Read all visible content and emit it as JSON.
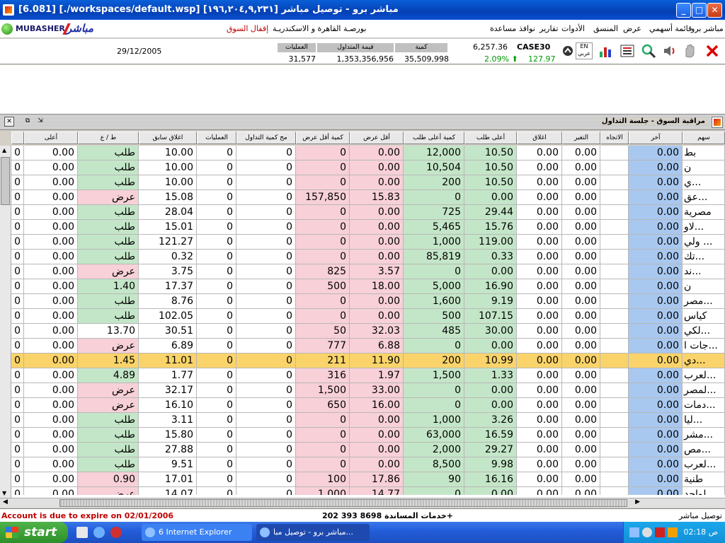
{
  "window": {
    "title": "[6.081]  [./workspaces/default.wsp]  مباشر برو - توصيل مباشر [١٩٦,٢٠٤,٩,٢٣١]",
    "minimize": "_",
    "maximize": "□",
    "close": "✕"
  },
  "logo": {
    "word": "MUBASHER",
    "arabic": "مباشر"
  },
  "menu": {
    "items": [
      "مباشر برو",
      "قائمة أسهمي",
      "عرض",
      "المنسق",
      "الأدوات",
      "تقارير",
      "نوافذ",
      "مساعدة"
    ],
    "exchange": "بورصـة القاهرة و الاسكندريـة",
    "market_status": "إقفال السوق"
  },
  "infobar": {
    "date": "29/12/2005",
    "labels": {
      "trades": "العمليات",
      "value": "قيمة المتداول",
      "volume": "كمية"
    },
    "values": {
      "trades": "31,577",
      "value": "1,353,356,956",
      "volume": "35,509,998"
    },
    "index_name": "CASE30",
    "index_value": "6,257.36",
    "index_pct": "2.09%",
    "index_change": "127.97",
    "lang_btn": "EN عربي",
    "colors": {
      "up": "#009900",
      "expire": "#c00000"
    }
  },
  "panel": {
    "title": "مراقبة السوق - جلسة التداول"
  },
  "columns": [
    "أعلى",
    "ط / ع",
    "اغلاق سابق",
    "العمليات",
    "مج كمية التداول",
    "كمية أقل عرض",
    "أقل عرض",
    "كمية أعلى طلب",
    "أعلى طلب",
    "اغلاق",
    "التغير",
    "الاتجاه",
    "آخر",
    "سهم"
  ],
  "rows": [
    {
      "high": "0.00",
      "bs": "طلب",
      "bs_type": "bid",
      "prev": "10.00",
      "trades": "0",
      "vol": "0",
      "ask_qty": "0",
      "ask": "0.00",
      "bid_qty": "12,000",
      "bid": "10.50",
      "close": "0.00",
      "chg": "0.00",
      "last": "0.00",
      "sym": "بط"
    },
    {
      "high": "0.00",
      "bs": "طلب",
      "bs_type": "bid",
      "prev": "10.00",
      "trades": "0",
      "vol": "0",
      "ask_qty": "0",
      "ask": "0.00",
      "bid_qty": "10,504",
      "bid": "10.50",
      "close": "0.00",
      "chg": "0.00",
      "last": "0.00",
      "sym": "ن"
    },
    {
      "high": "0.00",
      "bs": "طلب",
      "bs_type": "bid",
      "prev": "10.00",
      "trades": "0",
      "vol": "0",
      "ask_qty": "0",
      "ask": "0.00",
      "bid_qty": "200",
      "bid": "10.50",
      "close": "0.00",
      "chg": "0.00",
      "last": "0.00",
      "sym": "ي..."
    },
    {
      "high": "0.00",
      "bs": "عرض",
      "bs_type": "ask",
      "prev": "15.08",
      "trades": "0",
      "vol": "0",
      "ask_qty": "157,850",
      "ask": "15.83",
      "bid_qty": "0",
      "bid": "0.00",
      "close": "0.00",
      "chg": "0.00",
      "last": "0.00",
      "sym": "عق..."
    },
    {
      "high": "0.00",
      "bs": "طلب",
      "bs_type": "bid",
      "prev": "28.04",
      "trades": "0",
      "vol": "0",
      "ask_qty": "0",
      "ask": "0.00",
      "bid_qty": "725",
      "bid": "29.44",
      "close": "0.00",
      "chg": "0.00",
      "last": "0.00",
      "sym": "مصرية"
    },
    {
      "high": "0.00",
      "bs": "طلب",
      "bs_type": "bid",
      "prev": "15.01",
      "trades": "0",
      "vol": "0",
      "ask_qty": "0",
      "ask": "0.00",
      "bid_qty": "5,465",
      "bid": "15.76",
      "close": "0.00",
      "chg": "0.00",
      "last": "0.00",
      "sym": "لاو..."
    },
    {
      "high": "0.00",
      "bs": "طلب",
      "bs_type": "bid",
      "prev": "121.27",
      "trades": "0",
      "vol": "0",
      "ask_qty": "0",
      "ask": "0.00",
      "bid_qty": "1,000",
      "bid": "119.00",
      "close": "0.00",
      "chg": "0.00",
      "last": "0.00",
      "sym": "ولي ..."
    },
    {
      "high": "0.00",
      "bs": "طلب",
      "bs_type": "bid",
      "prev": "0.32",
      "trades": "0",
      "vol": "0",
      "ask_qty": "0",
      "ask": "0.00",
      "bid_qty": "85,819",
      "bid": "0.33",
      "close": "0.00",
      "chg": "0.00",
      "last": "0.00",
      "sym": "تك..."
    },
    {
      "high": "0.00",
      "bs": "عرض",
      "bs_type": "ask",
      "prev": "3.75",
      "trades": "0",
      "vol": "0",
      "ask_qty": "825",
      "ask": "3.57",
      "bid_qty": "0",
      "bid": "0.00",
      "close": "0.00",
      "chg": "0.00",
      "last": "0.00",
      "sym": "ند..."
    },
    {
      "high": "0.00",
      "bs": "1.40",
      "bs_type": "bid",
      "prev": "17.37",
      "trades": "0",
      "vol": "0",
      "ask_qty": "500",
      "ask": "18.00",
      "bid_qty": "5,000",
      "bid": "16.90",
      "close": "0.00",
      "chg": "0.00",
      "last": "0.00",
      "sym": "ن"
    },
    {
      "high": "0.00",
      "bs": "طلب",
      "bs_type": "bid",
      "prev": "8.76",
      "trades": "0",
      "vol": "0",
      "ask_qty": "0",
      "ask": "0.00",
      "bid_qty": "1,600",
      "bid": "9.19",
      "close": "0.00",
      "chg": "0.00",
      "last": "0.00",
      "sym": "مصر..."
    },
    {
      "high": "0.00",
      "bs": "طلب",
      "bs_type": "bid",
      "prev": "102.05",
      "trades": "0",
      "vol": "0",
      "ask_qty": "0",
      "ask": "0.00",
      "bid_qty": "500",
      "bid": "107.15",
      "close": "0.00",
      "chg": "0.00",
      "last": "0.00",
      "sym": "كياس"
    },
    {
      "high": "0.00",
      "bs": "13.70",
      "bs_type": "plain",
      "prev": "30.51",
      "trades": "0",
      "vol": "0",
      "ask_qty": "50",
      "ask": "32.03",
      "bid_qty": "485",
      "bid": "30.00",
      "close": "0.00",
      "chg": "0.00",
      "last": "0.00",
      "sym": "لكي..."
    },
    {
      "high": "0.00",
      "bs": "عرض",
      "bs_type": "ask",
      "prev": "6.89",
      "trades": "0",
      "vol": "0",
      "ask_qty": "777",
      "ask": "6.88",
      "bid_qty": "0",
      "bid": "0.00",
      "close": "0.00",
      "chg": "0.00",
      "last": "0.00",
      "sym": "جات ا..."
    },
    {
      "high": "0.00",
      "bs": "1.45",
      "bs_type": "bid",
      "prev": "11.01",
      "trades": "0",
      "vol": "0",
      "ask_qty": "211",
      "ask": "11.90",
      "bid_qty": "200",
      "bid": "10.99",
      "close": "0.00",
      "chg": "0.00",
      "last": "0.00",
      "sym": "دي...",
      "highlight": true
    },
    {
      "high": "0.00",
      "bs": "4.89",
      "bs_type": "bid",
      "prev": "1.77",
      "trades": "0",
      "vol": "0",
      "ask_qty": "316",
      "ask": "1.97",
      "bid_qty": "1,500",
      "bid": "1.33",
      "close": "0.00",
      "chg": "0.00",
      "last": "0.00",
      "sym": "لعرب..."
    },
    {
      "high": "0.00",
      "bs": "عرض",
      "bs_type": "ask",
      "prev": "32.17",
      "trades": "0",
      "vol": "0",
      "ask_qty": "1,500",
      "ask": "33.00",
      "bid_qty": "0",
      "bid": "0.00",
      "close": "0.00",
      "chg": "0.00",
      "last": "0.00",
      "sym": "لمصر..."
    },
    {
      "high": "0.00",
      "bs": "عرض",
      "bs_type": "ask",
      "prev": "16.10",
      "trades": "0",
      "vol": "0",
      "ask_qty": "650",
      "ask": "16.00",
      "bid_qty": "0",
      "bid": "0.00",
      "close": "0.00",
      "chg": "0.00",
      "last": "0.00",
      "sym": "دمات..."
    },
    {
      "high": "0.00",
      "bs": "طلب",
      "bs_type": "bid",
      "prev": "3.11",
      "trades": "0",
      "vol": "0",
      "ask_qty": "0",
      "ask": "0.00",
      "bid_qty": "1,000",
      "bid": "3.26",
      "close": "0.00",
      "chg": "0.00",
      "last": "0.00",
      "sym": "ليا..."
    },
    {
      "high": "0.00",
      "bs": "طلب",
      "bs_type": "bid",
      "prev": "15.80",
      "trades": "0",
      "vol": "0",
      "ask_qty": "0",
      "ask": "0.00",
      "bid_qty": "63,000",
      "bid": "16.59",
      "close": "0.00",
      "chg": "0.00",
      "last": "0.00",
      "sym": "مشر..."
    },
    {
      "high": "0.00",
      "bs": "طلب",
      "bs_type": "bid",
      "prev": "27.88",
      "trades": "0",
      "vol": "0",
      "ask_qty": "0",
      "ask": "0.00",
      "bid_qty": "2,000",
      "bid": "29.27",
      "close": "0.00",
      "chg": "0.00",
      "last": "0.00",
      "sym": "مص..."
    },
    {
      "high": "0.00",
      "bs": "طلب",
      "bs_type": "bid",
      "prev": "9.51",
      "trades": "0",
      "vol": "0",
      "ask_qty": "0",
      "ask": "0.00",
      "bid_qty": "8,500",
      "bid": "9.98",
      "close": "0.00",
      "chg": "0.00",
      "last": "0.00",
      "sym": "لعرب..."
    },
    {
      "high": "0.00",
      "bs": "0.90",
      "bs_type": "ask",
      "prev": "17.01",
      "trades": "0",
      "vol": "0",
      "ask_qty": "100",
      "ask": "17.86",
      "bid_qty": "90",
      "bid": "16.16",
      "close": "0.00",
      "chg": "0.00",
      "last": "0.00",
      "sym": "طنية"
    },
    {
      "high": "0.00",
      "bs": "عرض",
      "bs_type": "ask",
      "prev": "14.07",
      "trades": "0",
      "vol": "0",
      "ask_qty": "1,000",
      "ask": "14.77",
      "bid_qty": "0",
      "bid": "0.00",
      "close": "0.00",
      "chg": "0.00",
      "last": "0.00",
      "sym": "لواحد"
    }
  ],
  "status": {
    "expire": "Account is due to expire on 02/01/2006",
    "service": "خدمات المساندة  8698 393 202+",
    "connection": "توصيل مباشر"
  },
  "taskbar": {
    "start": "start",
    "tasks": [
      "6 Internet Explorer",
      "مباشر برو - توصيل مبا..."
    ],
    "clock": "02:18 ص"
  }
}
